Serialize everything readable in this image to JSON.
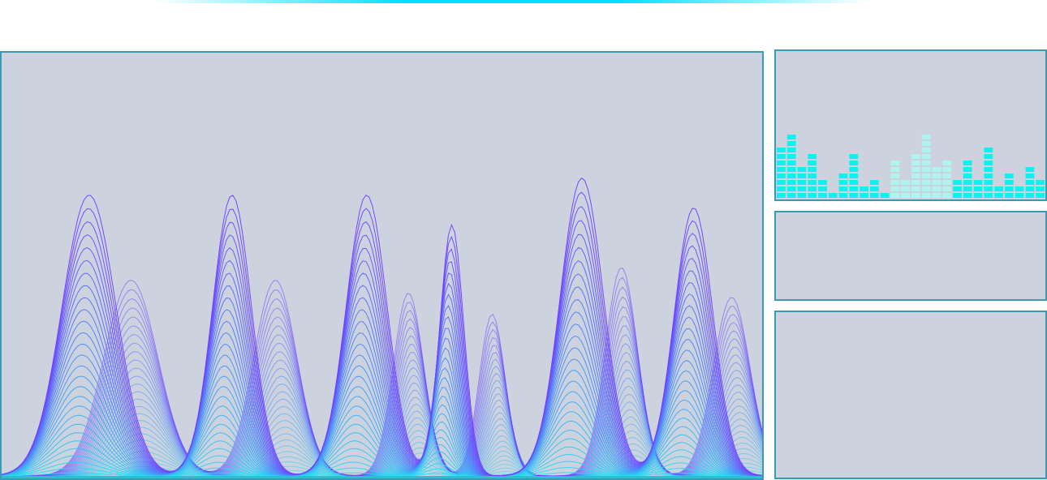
{
  "colors": {
    "panel_bg": "#ccd3df",
    "panel_border": "#3a9ab4",
    "glow": "#00e0ff",
    "wave_top": "#7040ff",
    "wave_bottom": "#20e8f0",
    "eq_bright": "#10f0f0",
    "eq_pale": "#b0f4f0"
  },
  "visualizer": {
    "layers": 28,
    "front_peaks": [
      {
        "pos": 0.115,
        "amp": 0.66,
        "width": 0.05
      },
      {
        "pos": 0.303,
        "amp": 0.66,
        "width": 0.036
      },
      {
        "pos": 0.48,
        "amp": 0.66,
        "width": 0.038
      },
      {
        "pos": 0.592,
        "amp": 0.59,
        "width": 0.022
      },
      {
        "pos": 0.763,
        "amp": 0.7,
        "width": 0.04
      },
      {
        "pos": 0.91,
        "amp": 0.63,
        "width": 0.036
      }
    ],
    "back_peaks": [
      {
        "pos": 0.17,
        "amp": 0.46,
        "width": 0.05
      },
      {
        "pos": 0.36,
        "amp": 0.46,
        "width": 0.04
      },
      {
        "pos": 0.535,
        "amp": 0.43,
        "width": 0.028
      },
      {
        "pos": 0.645,
        "amp": 0.38,
        "width": 0.024
      },
      {
        "pos": 0.815,
        "amp": 0.49,
        "width": 0.03
      },
      {
        "pos": 0.96,
        "amp": 0.42,
        "width": 0.034
      }
    ]
  },
  "equalizer": {
    "bars": [
      {
        "level": 8,
        "pale": false
      },
      {
        "level": 10,
        "pale": false
      },
      {
        "level": 5,
        "pale": false
      },
      {
        "level": 7,
        "pale": false
      },
      {
        "level": 3,
        "pale": false
      },
      {
        "level": 1,
        "pale": false
      },
      {
        "level": 4,
        "pale": false
      },
      {
        "level": 7,
        "pale": false
      },
      {
        "level": 2,
        "pale": false
      },
      {
        "level": 3,
        "pale": false
      },
      {
        "level": 1,
        "pale": false
      },
      {
        "level": 6,
        "pale": true
      },
      {
        "level": 3,
        "pale": true
      },
      {
        "level": 7,
        "pale": true
      },
      {
        "level": 10,
        "pale": true
      },
      {
        "level": 5,
        "pale": true
      },
      {
        "level": 6,
        "pale": true
      },
      {
        "level": 3,
        "pale": false
      },
      {
        "level": 6,
        "pale": false
      },
      {
        "level": 3,
        "pale": false
      },
      {
        "level": 8,
        "pale": false
      },
      {
        "level": 2,
        "pale": false
      },
      {
        "level": 4,
        "pale": false
      },
      {
        "level": 2,
        "pale": false
      },
      {
        "level": 5,
        "pale": false
      },
      {
        "level": 3,
        "pale": false
      }
    ]
  }
}
